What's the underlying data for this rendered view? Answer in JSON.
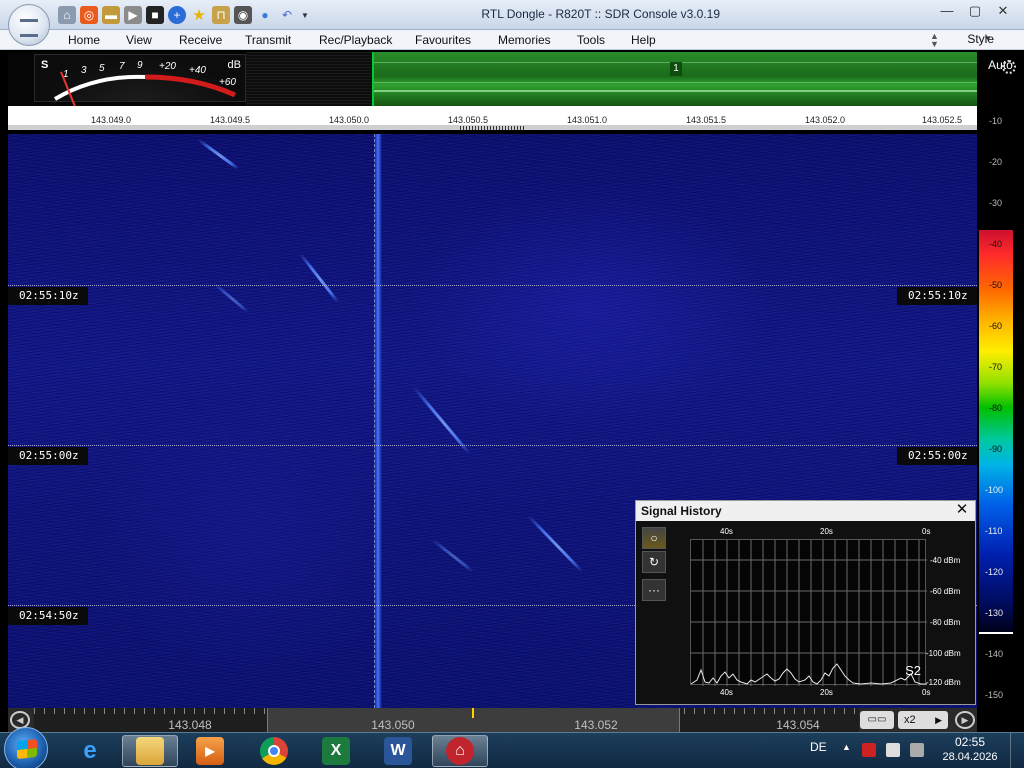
{
  "window": {
    "title": "RTL Dongle - R820T :: SDR Console v3.0.19",
    "controls": [
      "—",
      "▢",
      "✕"
    ]
  },
  "quick_access": [
    "home-icon",
    "lifebuoy-icon",
    "folder-icon",
    "play-icon",
    "stop-icon",
    "plus-icon",
    "star-icon",
    "lock-icon",
    "camera-icon",
    "drop-icon",
    "undo-icon"
  ],
  "menu": {
    "items": [
      "Home",
      "View",
      "Receive",
      "Transmit",
      "Rec/Playback",
      "Favourites",
      "Memories",
      "Tools",
      "Help"
    ],
    "style_label": "Style"
  },
  "smeter": {
    "s_label": "S",
    "db_label": "dB",
    "scale_labels": [
      "1",
      "3",
      "5",
      "7",
      "9",
      "+20",
      "+40",
      "+60"
    ]
  },
  "overview": {
    "marker": "1"
  },
  "freq_scale": {
    "labels": [
      "143.049.0",
      "143.049.5",
      "143.050.0",
      "143.050.5",
      "143.051.0",
      "143.051.5",
      "143.052.0",
      "143.052.5"
    ]
  },
  "right_scale": {
    "auto_label": "Auto",
    "ticks": [
      "-10",
      "-20",
      "-30",
      "-40",
      "-50",
      "-60",
      "-70",
      "-80",
      "-90",
      "-100",
      "-110",
      "-120",
      "-130",
      "-140",
      "-150"
    ]
  },
  "waterfall": {
    "time_markers": [
      "02:55:10z",
      "02:55:00z",
      "02:54:50z"
    ],
    "colors": {
      "background": "#11167a",
      "signal": "#4f80ff"
    }
  },
  "signal_history": {
    "title": "Signal History",
    "close": "✕",
    "tools": [
      "○",
      "↻",
      "···"
    ],
    "time_top": [
      "40s",
      "20s",
      "0s"
    ],
    "time_bottom": [
      "40s",
      "20s",
      "0s"
    ],
    "dbm_labels": [
      "-40 dBm",
      "-60 dBm",
      "-80 dBm",
      "-100 dBm",
      "-120 dBm"
    ],
    "s_value": "S2"
  },
  "band_bar": {
    "labels": [
      "143.048",
      "143.050",
      "143.052",
      "143.054"
    ],
    "zoom": "x2",
    "zoom_arrow": "▶"
  },
  "taskbar": {
    "apps": [
      "ie-icon",
      "explorer-icon",
      "media-player-icon",
      "chrome-icon",
      "excel-icon",
      "word-icon",
      "sdr-console-icon"
    ],
    "language": "DE",
    "tray_arrow": "▲",
    "time": "02:55",
    "date": "28.04.2026"
  }
}
